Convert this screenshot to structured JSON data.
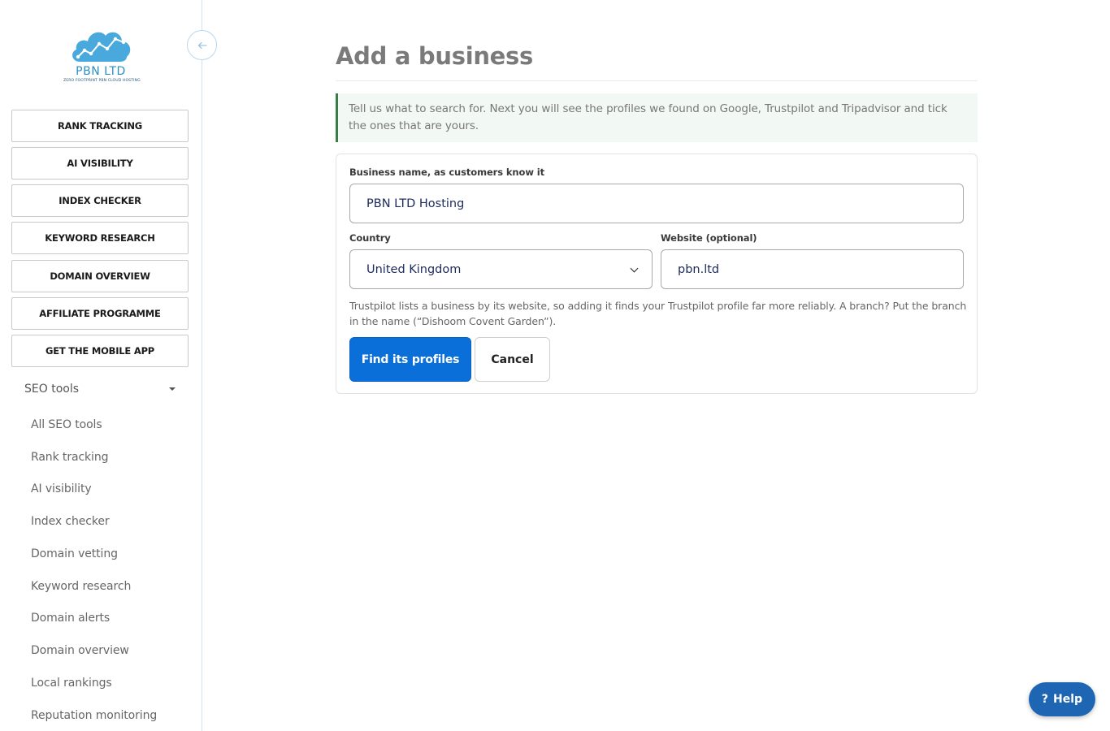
{
  "brand": {
    "name": "PBN LTD",
    "tagline": "ZERO FOOTPRINT PBN CLOUD HOSTING",
    "color": "#2c8fc4"
  },
  "sidebar": {
    "collapse_icon": "arrow-left-icon",
    "buttons": [
      "RANK TRACKING",
      "AI VISIBILITY",
      "INDEX CHECKER",
      "KEYWORD RESEARCH",
      "DOMAIN OVERVIEW",
      "AFFILIATE PROGRAMME",
      "GET THE MOBILE APP"
    ],
    "section": {
      "label": "SEO tools",
      "icon": "caret-down-icon",
      "items": [
        "All SEO tools",
        "Rank tracking",
        "AI visibility",
        "Index checker",
        "Domain vetting",
        "Keyword research",
        "Domain alerts",
        "Domain overview",
        "Local rankings",
        "Reputation monitoring"
      ]
    }
  },
  "main": {
    "title": "Add a business",
    "notice": "Tell us what to search for. Next you will see the profiles we found on Google, Trustpilot and Tripadvisor and tick the ones that are yours.",
    "form": {
      "business_name_label": "Business name, as customers know it",
      "business_name_value": "PBN LTD Hosting",
      "country_label": "Country",
      "country_value": "United Kingdom",
      "website_label": "Website (optional)",
      "website_value": "pbn.ltd",
      "help_text": "Trustpilot lists a business by its website, so adding it finds your Trustpilot profile far more reliably. A branch? Put the branch in the name (“Dishoom Covent Garden”).",
      "submit_label": "Find its profiles",
      "cancel_label": "Cancel"
    }
  },
  "help_button": {
    "icon": "?",
    "label": "Help"
  },
  "colors": {
    "primary": "#0a6fd8",
    "notice_border": "#3a7d48",
    "notice_bg": "#f2f8f4",
    "help_bg": "#1e66b4"
  }
}
